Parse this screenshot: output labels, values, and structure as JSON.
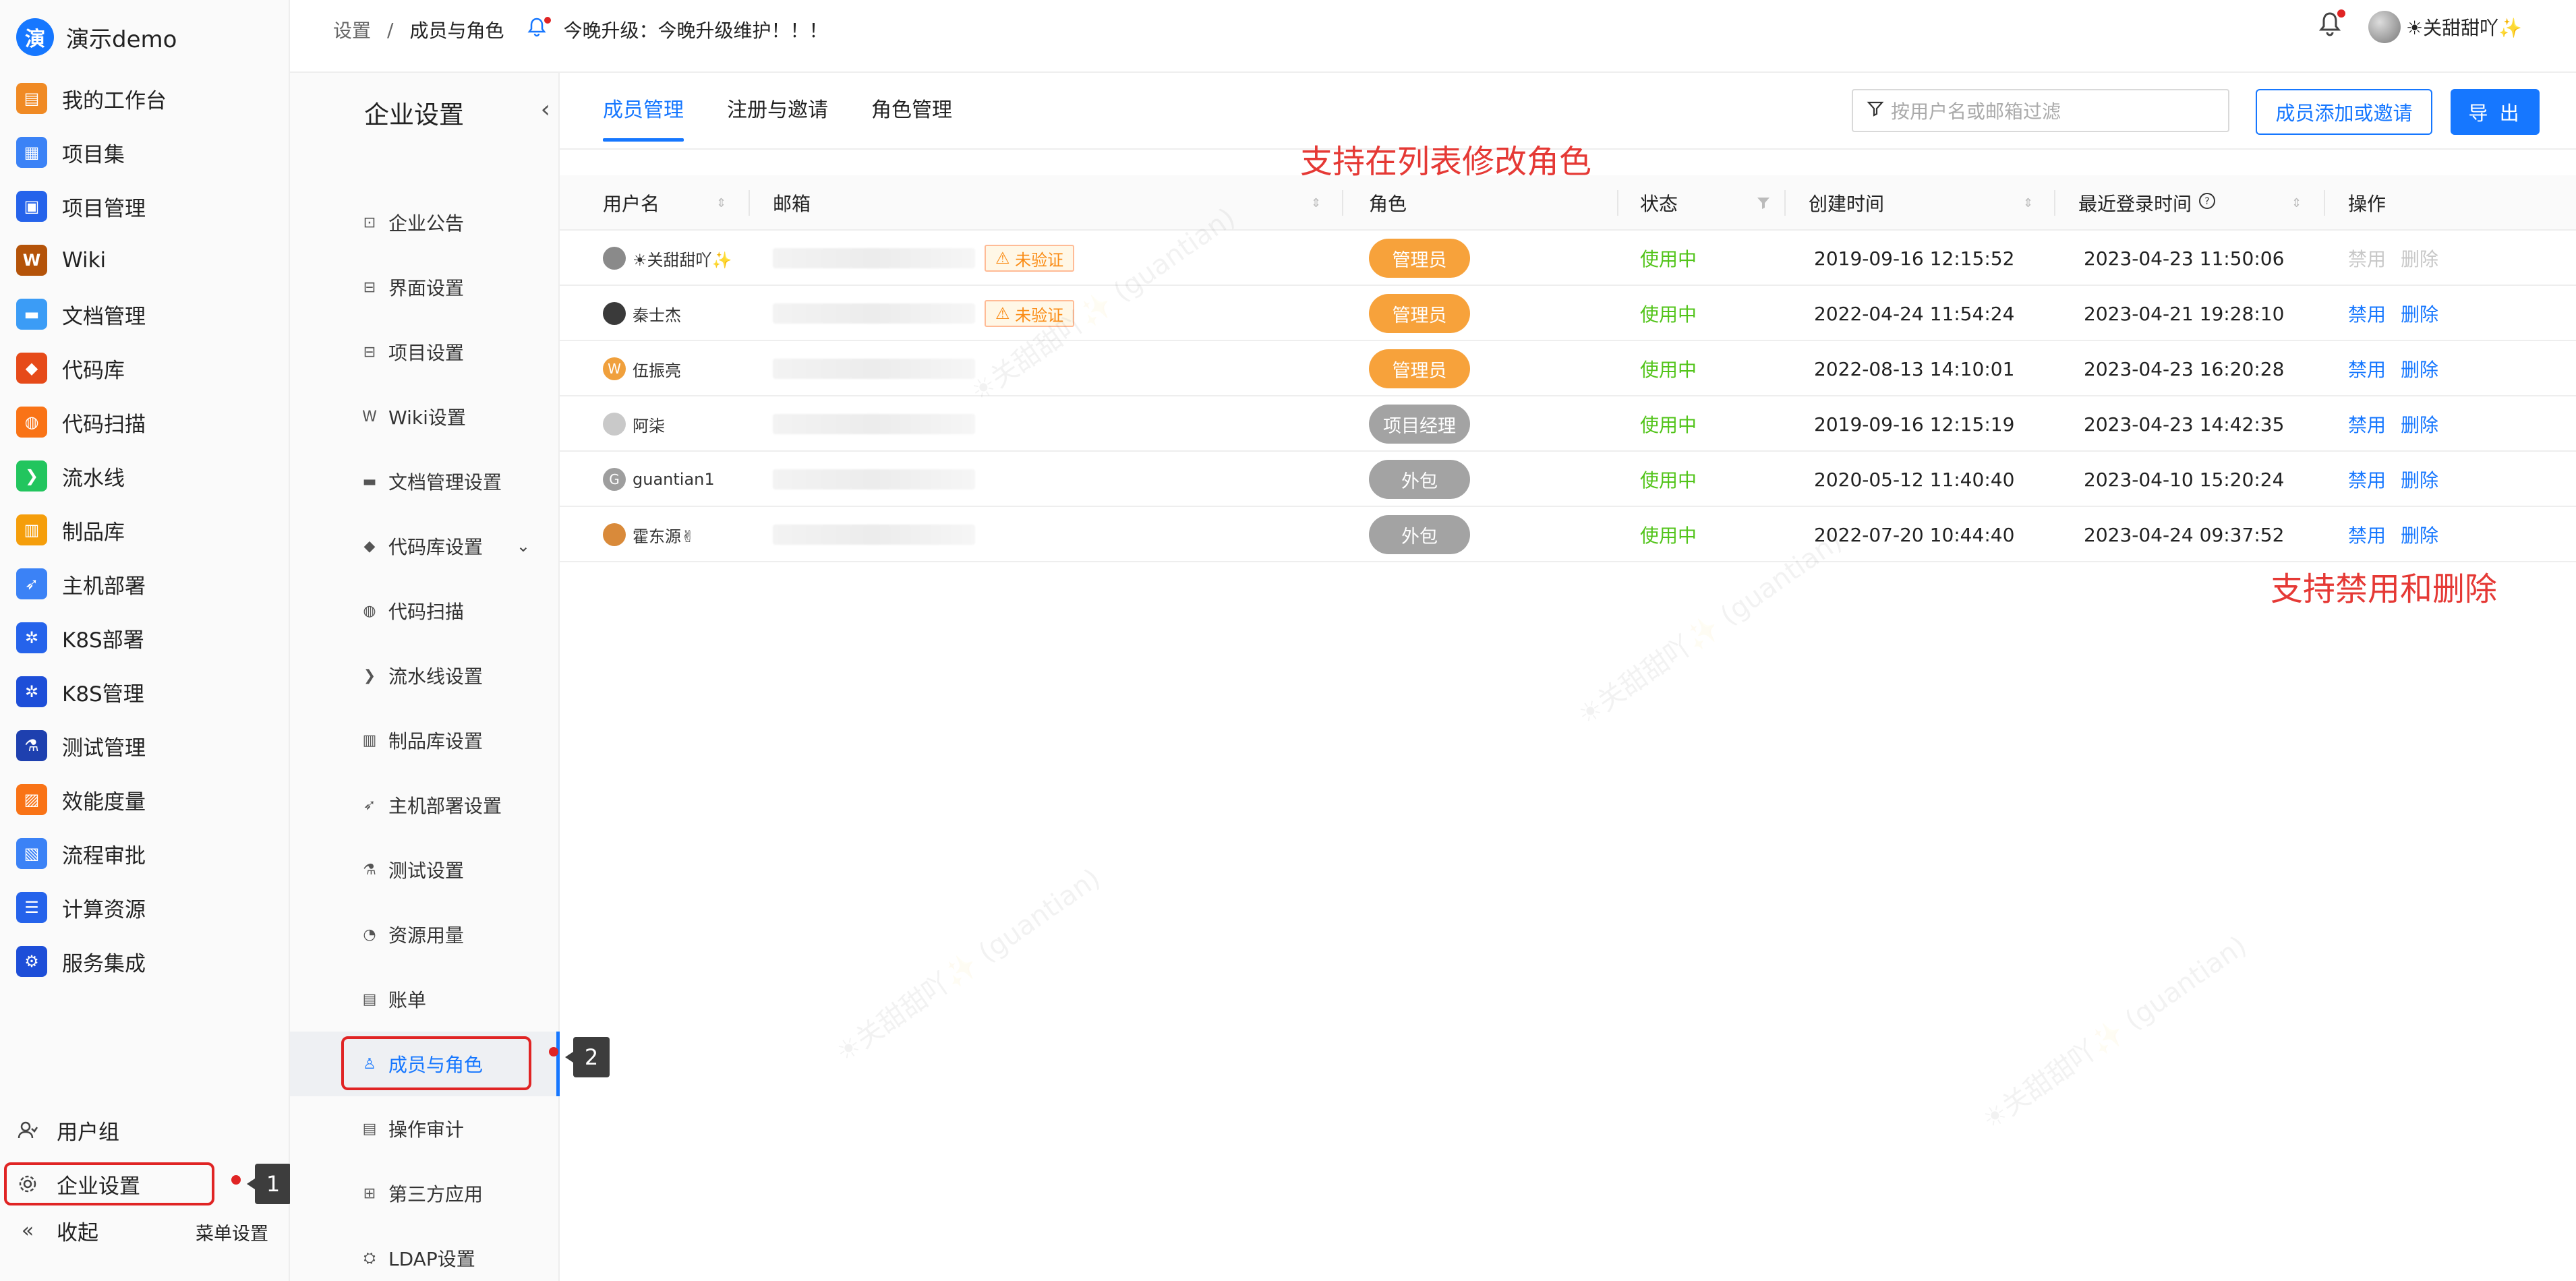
{
  "brand": {
    "logo_char": "演",
    "name": "演示demo"
  },
  "left_nav": [
    {
      "label": "我的工作台",
      "icon": "workbench-icon",
      "color": "#f08a24",
      "glyph": "▤"
    },
    {
      "label": "项目集",
      "icon": "project-set-icon",
      "color": "#3b82f6",
      "glyph": "▦"
    },
    {
      "label": "项目管理",
      "icon": "project-management-icon",
      "color": "#2563eb",
      "glyph": "▣"
    },
    {
      "label": "Wiki",
      "icon": "wiki-icon",
      "color": "#b45309",
      "glyph": "W"
    },
    {
      "label": "文档管理",
      "icon": "folder-icon",
      "color": "#3b9cf6",
      "glyph": "▬"
    },
    {
      "label": "代码库",
      "icon": "git-icon",
      "color": "#e64a19",
      "glyph": "◆"
    },
    {
      "label": "代码扫描",
      "icon": "code-scan-icon",
      "color": "#f97316",
      "glyph": "◍"
    },
    {
      "label": "流水线",
      "icon": "pipeline-icon",
      "color": "#22c55e",
      "glyph": "❯"
    },
    {
      "label": "制品库",
      "icon": "artifact-icon",
      "color": "#f59e0b",
      "glyph": "▥"
    },
    {
      "label": "主机部署",
      "icon": "rocket-icon",
      "color": "#3b82f6",
      "glyph": "➶"
    },
    {
      "label": "K8S部署",
      "icon": "k8s-deploy-icon",
      "color": "#2563eb",
      "glyph": "✲"
    },
    {
      "label": "K8S管理",
      "icon": "k8s-manage-icon",
      "color": "#1d4ed8",
      "glyph": "✲"
    },
    {
      "label": "测试管理",
      "icon": "flask-icon",
      "color": "#1e40af",
      "glyph": "⚗"
    },
    {
      "label": "效能度量",
      "icon": "metrics-icon",
      "color": "#f97316",
      "glyph": "▨"
    },
    {
      "label": "流程审批",
      "icon": "approval-icon",
      "color": "#3b82f6",
      "glyph": "▧"
    },
    {
      "label": "计算资源",
      "icon": "compute-icon",
      "color": "#2563eb",
      "glyph": "☰"
    },
    {
      "label": "服务集成",
      "icon": "integration-icon",
      "color": "#1d4ed8",
      "glyph": "⚙"
    }
  ],
  "nav_bottom": {
    "user_group": "用户组",
    "enterprise_settings": "企业设置",
    "collapse": "收起",
    "menu_settings": "菜单设置",
    "collapse_glyph": "«"
  },
  "markers": {
    "m1": "1",
    "m2": "2"
  },
  "sub_nav": {
    "title": "企业设置",
    "collapse_glyph": "‹",
    "items": [
      {
        "label": "企业公告",
        "icon": "announcement-icon",
        "glyph": "⊡"
      },
      {
        "label": "界面设置",
        "icon": "interface-icon",
        "glyph": "⊟"
      },
      {
        "label": "项目设置",
        "icon": "project-settings-icon",
        "glyph": "⊟"
      },
      {
        "label": "Wiki设置",
        "icon": "wiki-settings-icon",
        "glyph": "W"
      },
      {
        "label": "文档管理设置",
        "icon": "doc-settings-icon",
        "glyph": "▬"
      },
      {
        "label": "代码库设置",
        "icon": "repo-settings-icon",
        "glyph": "◆"
      },
      {
        "label": "代码扫描",
        "icon": "scan-settings-icon",
        "glyph": "◍"
      },
      {
        "label": "流水线设置",
        "icon": "pipeline-settings-icon",
        "glyph": "❯"
      },
      {
        "label": "制品库设置",
        "icon": "artifact-settings-icon",
        "glyph": "▥"
      },
      {
        "label": "主机部署设置",
        "icon": "host-deploy-settings-icon",
        "glyph": "➶"
      },
      {
        "label": "测试设置",
        "icon": "test-settings-icon",
        "glyph": "⚗"
      },
      {
        "label": "资源用量",
        "icon": "resource-usage-icon",
        "glyph": "◔"
      },
      {
        "label": "账单",
        "icon": "bill-icon",
        "glyph": "▤"
      },
      {
        "label": "成员与角色",
        "icon": "user-icon",
        "glyph": "♙"
      },
      {
        "label": "操作审计",
        "icon": "audit-icon",
        "glyph": "▤"
      },
      {
        "label": "第三方应用",
        "icon": "apps-icon",
        "glyph": "⊞"
      },
      {
        "label": "LDAP设置",
        "icon": "ldap-icon",
        "glyph": "⛭"
      }
    ],
    "expand_glyph": "⌄"
  },
  "topbar": {
    "breadcrumb": [
      "设置",
      "/",
      "成员与角色"
    ],
    "notice": "今晚升级：今晚升级维护！！！",
    "username": "☀关甜甜吖✨"
  },
  "tabs": [
    "成员管理",
    "注册与邀请",
    "角色管理"
  ],
  "filter": {
    "placeholder": "按用户名或邮箱过滤"
  },
  "buttons": {
    "add_invite": "成员添加或邀请",
    "export": "导 出"
  },
  "annotations": {
    "edit_role": "支持在列表修改角色",
    "disable_delete": "支持禁用和删除"
  },
  "table": {
    "headers": {
      "username": "用户名",
      "email": "邮箱",
      "role": "角色",
      "status": "状态",
      "created": "创建时间",
      "last_login": "最近登录时间",
      "actions": "操作"
    },
    "rows": [
      {
        "name": "☀关甜甜吖✨",
        "avatar_char": "",
        "avatar_color": "#8a8a8a",
        "unverified": "未验证",
        "role": "管理员",
        "role_color": "#f7a23b",
        "status": "使用中",
        "created": "2019-09-16 12:15:52",
        "last_login": "2023-04-23 11:50:06",
        "disable": "禁用",
        "delete": "删除",
        "ops_disabled": true
      },
      {
        "name": "秦士杰",
        "avatar_char": "",
        "avatar_color": "#3a3a3a",
        "unverified": "未验证",
        "role": "管理员",
        "role_color": "#f7a23b",
        "status": "使用中",
        "created": "2022-04-24 11:54:24",
        "last_login": "2023-04-21 19:28:10",
        "disable": "禁用",
        "delete": "删除",
        "ops_disabled": false
      },
      {
        "name": "伍振亮",
        "avatar_char": "W",
        "avatar_color": "#f0a03c",
        "unverified": "",
        "role": "管理员",
        "role_color": "#f7a23b",
        "status": "使用中",
        "created": "2022-08-13 14:10:01",
        "last_login": "2023-04-23 16:20:28",
        "disable": "禁用",
        "delete": "删除",
        "ops_disabled": false
      },
      {
        "name": "阿柒",
        "avatar_char": "",
        "avatar_color": "#c9c9c9",
        "unverified": "",
        "role": "项目经理",
        "role_color": "#a3a3a3",
        "status": "使用中",
        "created": "2019-09-16 12:15:19",
        "last_login": "2023-04-23 14:42:35",
        "disable": "禁用",
        "delete": "删除",
        "ops_disabled": false
      },
      {
        "name": "guantian1",
        "avatar_char": "G",
        "avatar_color": "#9e9e9e",
        "unverified": "",
        "role": "外包",
        "role_color": "#a3a3a3",
        "status": "使用中",
        "created": "2020-05-12 11:40:40",
        "last_login": "2023-04-10 15:20:24",
        "disable": "禁用",
        "delete": "删除",
        "ops_disabled": false
      },
      {
        "name": "霍东源✌",
        "avatar_char": "",
        "avatar_color": "#d98a3a",
        "unverified": "",
        "role": "外包",
        "role_color": "#a3a3a3",
        "status": "使用中",
        "created": "2022-07-20 10:44:40",
        "last_login": "2023-04-24 09:37:52",
        "disable": "禁用",
        "delete": "删除",
        "ops_disabled": false
      }
    ]
  },
  "colors": {
    "primary": "#1677ff",
    "annotation": "#e53935",
    "status_green": "#52c41a",
    "admin_orange": "#f7a23b",
    "neutral_gray": "#a3a3a3"
  }
}
